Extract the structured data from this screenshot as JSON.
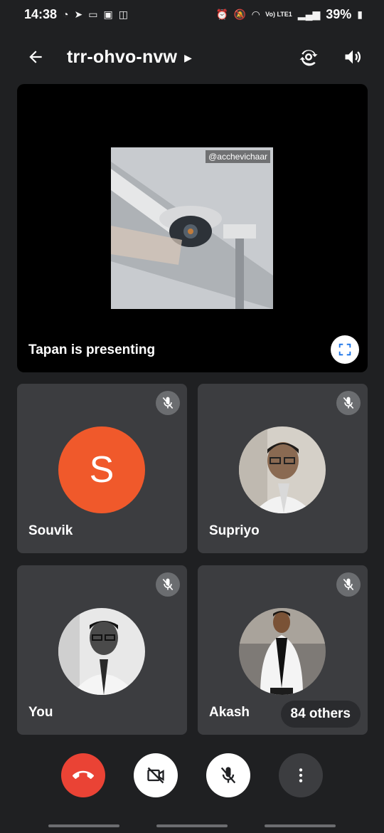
{
  "status_bar": {
    "time": "14:38",
    "battery": "39%",
    "net_label": "Vo) LTE1"
  },
  "meeting": {
    "code": "trr-ohvo-nvw"
  },
  "presentation": {
    "label": "Tapan is presenting",
    "watermark": "@acchevichaar"
  },
  "participants": [
    {
      "name": "Souvik",
      "initial": "S",
      "avatar_color": "#f0592b",
      "muted": true
    },
    {
      "name": "Supriyo",
      "muted": true
    },
    {
      "name": "You",
      "muted": true
    },
    {
      "name": "Akash",
      "muted": true
    }
  ],
  "others_badge": "84 others",
  "colors": {
    "end_call": "#ea4335",
    "tile_bg": "#3c3d40",
    "page_bg": "#1f2022"
  }
}
